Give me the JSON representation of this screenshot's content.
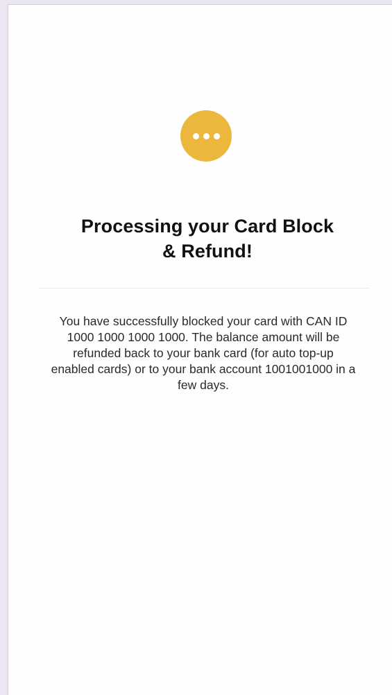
{
  "status": {
    "icon": "more-dots-icon",
    "color": "#ecb73d"
  },
  "title": {
    "line1": "Processing your Card Block",
    "line2": "& Refund!"
  },
  "message": {
    "text": "You have successfully blocked your card with CAN ID\n1000 1000 1000 1000.  The balance amount will be\nrefunded back to your bank card (for auto top-up\nenabled cards) or to your bank account 1001001000  in a\nfew days."
  }
}
